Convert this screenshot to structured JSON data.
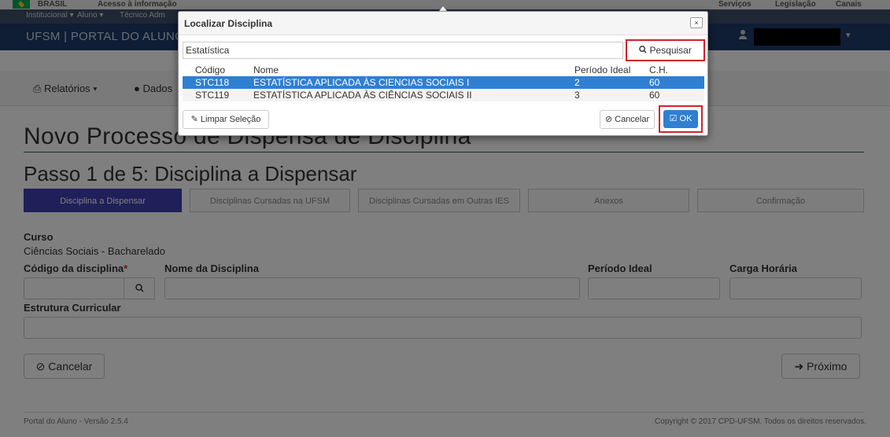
{
  "gov": {
    "country": "BRASIL",
    "info": "Acesso à informação",
    "services": "Serviços",
    "legislation": "Legislação",
    "channels": "Canais"
  },
  "topbar": {
    "institutional": "Institucional ▾",
    "student": "Aluno ▾",
    "tech": "Técnico Adm"
  },
  "navbar": {
    "brand": "UFSM | PORTAL DO ALUNO"
  },
  "subnav": {
    "reports": "Relatórios ▾",
    "data": "Dados"
  },
  "page": {
    "title": "Novo Processo de Dispensa de Disciplina",
    "step_title": "Passo 1 de 5: Disciplina a Dispensar",
    "steps": [
      "Disciplina a Dispensar",
      "Disciplinas Cursadas na UFSM",
      "Disciplinas Cursadas em Outras IES",
      "Anexos",
      "Confirmação"
    ],
    "course_label": "Curso",
    "course_value": "Ciências Sociais - Bacharelado",
    "code_label": "Código da disciplina",
    "required_mark": "*",
    "name_label": "Nome da Disciplina",
    "period_label": "Período Ideal",
    "hours_label": "Carga Horária",
    "structure_label": "Estrutura Curricular",
    "cancel": "Cancelar",
    "next": "Próximo"
  },
  "footer": {
    "version": "Portal do Aluno - Versão 2.5.4",
    "copyright": "Copyright © 2017 CPD-UFSM. Todos os direitos reservados."
  },
  "modal": {
    "title": "Localizar Disciplina",
    "close": "×",
    "search_value": "Estatística",
    "search_button": "Pesquisar",
    "columns": [
      "Código",
      "Nome",
      "Período Ideal",
      "C.H."
    ],
    "rows": [
      {
        "code": "STC118",
        "name": "ESTATÍSTICA APLICADA ÀS CIENCIAS SOCIAIS I",
        "period": "2",
        "hours": "60"
      },
      {
        "code": "STC119",
        "name": "ESTATÍSTICA APLICADA ÀS CIÊNCIAS SOCIAIS II",
        "period": "3",
        "hours": "60"
      }
    ],
    "clear_button": "Limpar Seleção",
    "cancel_button": "Cancelar",
    "ok_button": "OK"
  },
  "colors": {
    "highlight": "#d0222d",
    "selected_row": "#2f7fd2",
    "active_step": "#3f3fb5",
    "navbar": "#1e3a6a"
  }
}
